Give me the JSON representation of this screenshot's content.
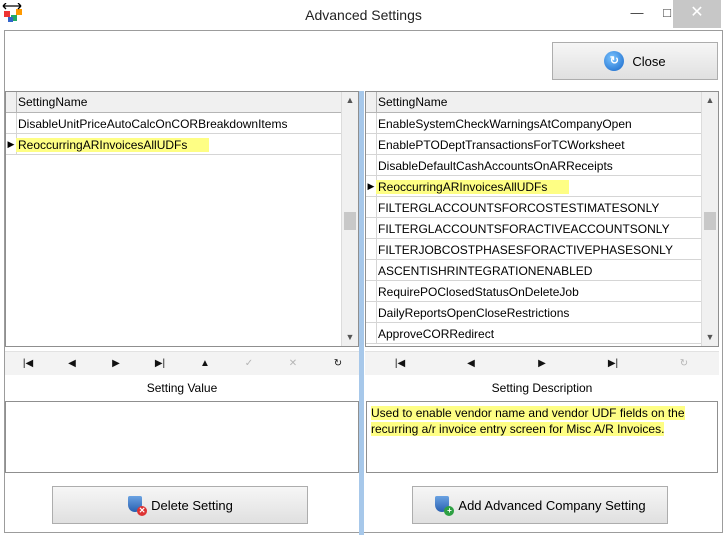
{
  "window": {
    "title": "Advanced Settings",
    "min_glyph": "—",
    "max_glyph": "□",
    "close_glyph": "✕"
  },
  "toolbar": {
    "close_label": "Close",
    "close_icon": "refresh-circle-icon"
  },
  "left_grid": {
    "column": "SettingName",
    "rows": [
      "DisableUnitPriceAutoCalcOnCORBreakdownItems",
      "ReoccurringARInvoicesAllUDFs"
    ],
    "current_row": 1
  },
  "right_grid": {
    "column": "SettingName",
    "rows": [
      "EnableSystemCheckWarningsAtCompanyOpen",
      "EnablePTODeptTransactionsForTCWorksheet",
      "DisableDefaultCashAccountsOnARReceipts",
      "ReoccurringARInvoicesAllUDFs",
      "FILTERGLACCOUNTSFORCOSTESTIMATESONLY",
      "FILTERGLACCOUNTSFORACTIVEACCOUNTSONLY",
      "FILTERJOBCOSTPHASESFORACTIVEPHASESONLY",
      "ASCENTISHRINTEGRATIONENABLED",
      "RequirePOClosedStatusOnDeleteJob",
      "DailyReportsOpenCloseRestrictions",
      "ApproveCORRedirect"
    ],
    "current_row": 3
  },
  "navigator_left": {
    "first": "|◀",
    "prev": "◀",
    "next": "▶",
    "last": "▶|",
    "insert": "▲",
    "post": "✓",
    "cancel": "✕",
    "refresh": "↻"
  },
  "navigator_right": {
    "first": "|◀",
    "prev": "◀",
    "next": "▶",
    "last": "▶|",
    "refresh": "↻"
  },
  "labels": {
    "setting_value": "Setting Value",
    "setting_description": "Setting Description"
  },
  "setting_value": "",
  "setting_description": "Used to enable vendor name and vendor UDF fields on the recurring a/r invoice entry screen for Misc A/R Invoices.",
  "buttons": {
    "delete_label": "Delete Setting",
    "add_label": "Add Advanced Company Setting"
  },
  "colors": {
    "highlight": "#fefe84",
    "divider": "#a7c8ea"
  }
}
